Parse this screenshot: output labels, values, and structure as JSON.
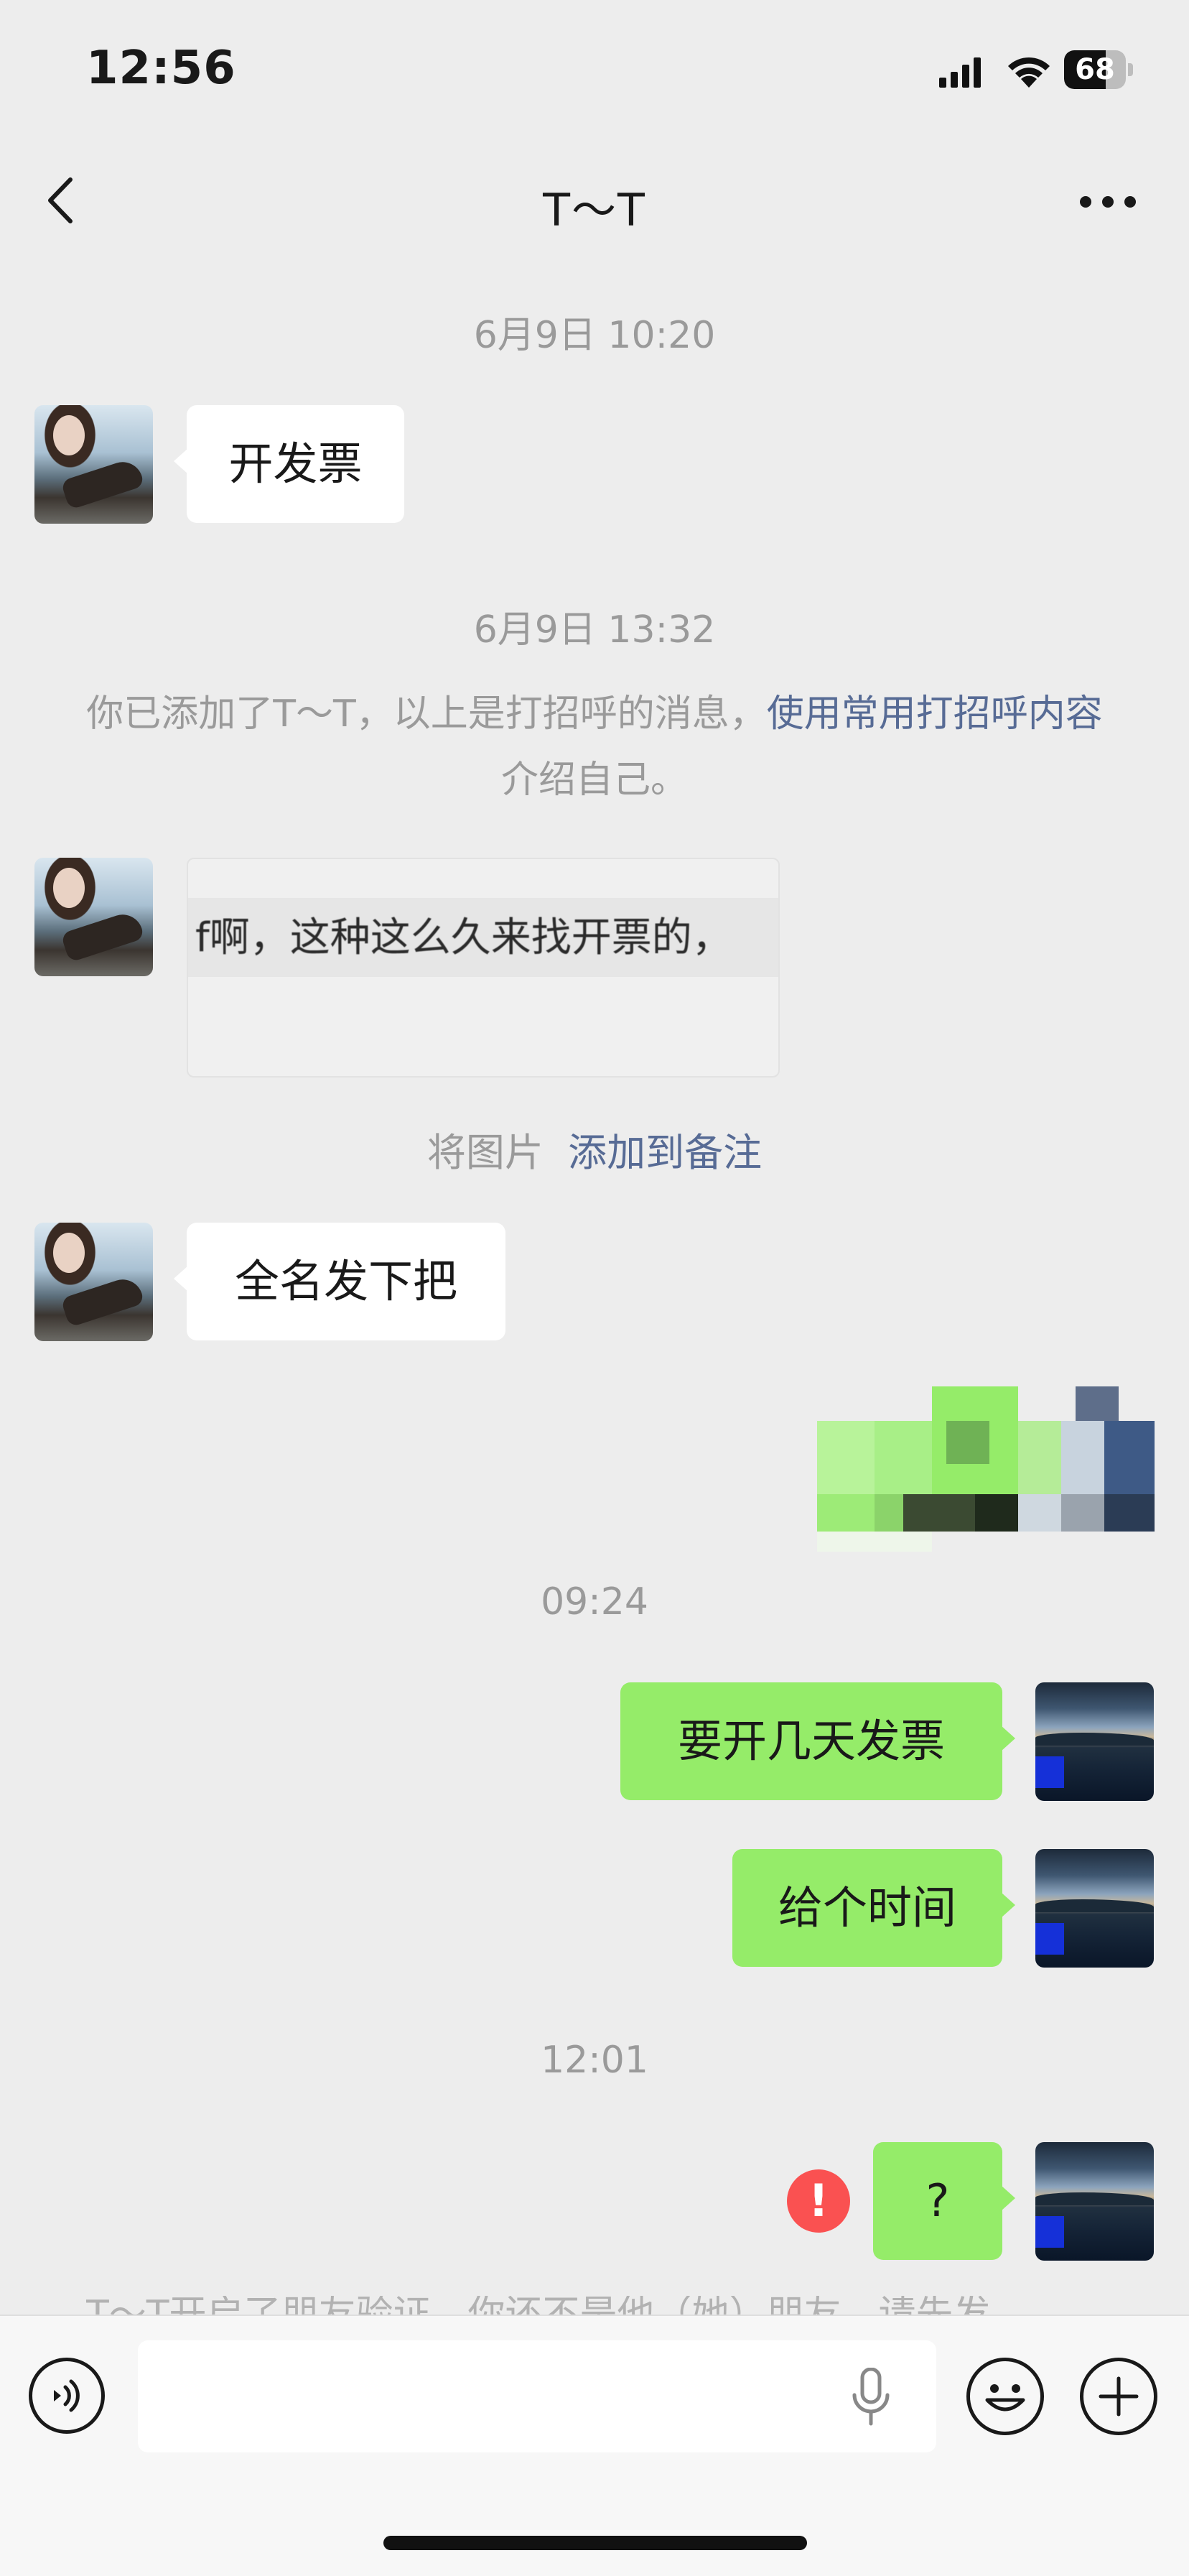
{
  "status_bar": {
    "time": "12:56",
    "battery": "68",
    "battery_level": 0.68,
    "icons": [
      "cellular-signal-icon",
      "wifi-icon",
      "battery-icon"
    ]
  },
  "nav": {
    "title": "T～T",
    "back_icon": "chevron-left-icon",
    "more_icon": "more-dots-icon"
  },
  "messages": {
    "ts1": "6月9日 10:20",
    "m1": "开发票",
    "ts2": "6月9日 13:32",
    "notice_prefix": "你已添加了T～T，以上是打招呼的消息，",
    "notice_link": "使用常用打招呼内容",
    "notice_suffix": "介绍自己。",
    "image_text": "f啊，这种这么久来找开票的，",
    "note_prefix": "将图片",
    "note_link": "添加到备注",
    "m2": "全名发下把",
    "ts3": "09:24",
    "m3": "要开几天发票",
    "m4": "给个时间",
    "ts4": "12:01",
    "m5": "?",
    "error_mark": "!",
    "cut_off_text": "T～T开启了朋友验证，你还不是他（她）朋友。请先发"
  },
  "colors": {
    "background": "#ededed",
    "bubble_green": "#95ec69",
    "bubble_white": "#ffffff",
    "link": "#576b95",
    "error": "#fa5151"
  },
  "input_bar": {
    "icons": [
      "voice-icon",
      "microphone-icon",
      "emoji-icon",
      "plus-icon"
    ]
  }
}
